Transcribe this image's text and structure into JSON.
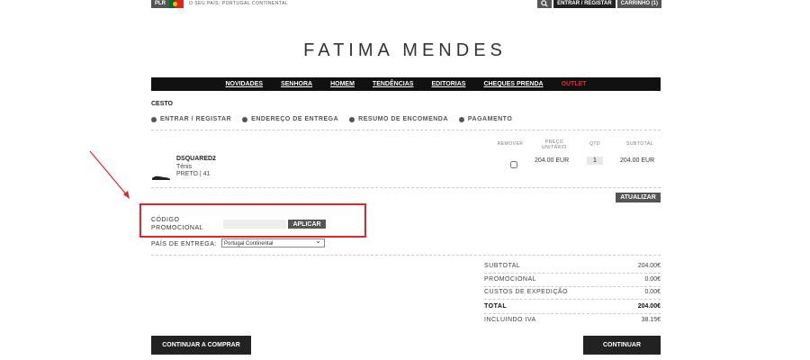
{
  "topbar": {
    "lang": "PLR",
    "country_note": "O SEU PAÍS: PORTUGAL CONTINENTAL",
    "search_icon": "search-icon",
    "login_label": "ENTRAR / REGISTAR",
    "cart_label": "CARRINHO (1)"
  },
  "brand": {
    "logo": "FATIMA MENDES"
  },
  "nav": {
    "items": [
      "NOVIDADES",
      "SENHORA",
      "HOMEM",
      "TENDÊNCIAS",
      "EDITORIAS",
      "CHEQUES PRENDA"
    ],
    "outlet": "OUTLET",
    "outlet_color": "#e8272c"
  },
  "cart": {
    "title": "CESTO",
    "steps": [
      "ENTRAR / REGISTAR",
      "ENDEREÇO DE ENTREGA",
      "RESUMO DE ENCOMENDA",
      "PAGAMENTO"
    ],
    "headers": {
      "remove": "REMOVER",
      "unit_price": "PREÇO UNITÁRIO",
      "qty": "QTD",
      "subtotal": "SUBTOTAL"
    },
    "item": {
      "name": "DSQUARED2",
      "type": "Ténis",
      "variant": "PRETO | 41",
      "unit_price": "204.00 EUR",
      "qty": "1",
      "subtotal": "204.00 EUR"
    },
    "update_label": "ATUALIZAR"
  },
  "promo": {
    "label": "CÓDIGO PROMOCIONAL",
    "input_value": "",
    "apply_label": "APLICAR"
  },
  "shipping": {
    "label": "PAÍS DE ENTREGA:",
    "selected": "Portugal Continental"
  },
  "summary": {
    "subtotal_label": "SUBTOTAL",
    "subtotal_value": "204.00€",
    "promo_label": "PROMOCIONAL",
    "promo_value": "0.00€",
    "shipping_label": "CUSTOS DE EXPEDIÇÃO",
    "shipping_value": "0.00€",
    "total_label": "TOTAL",
    "total_value": "204.00€",
    "vat_label": "INCLUINDO IVA",
    "vat_value": "38.15€"
  },
  "actions": {
    "continue_shopping": "CONTINUAR A COMPRAR",
    "continue": "CONTINUAR"
  }
}
